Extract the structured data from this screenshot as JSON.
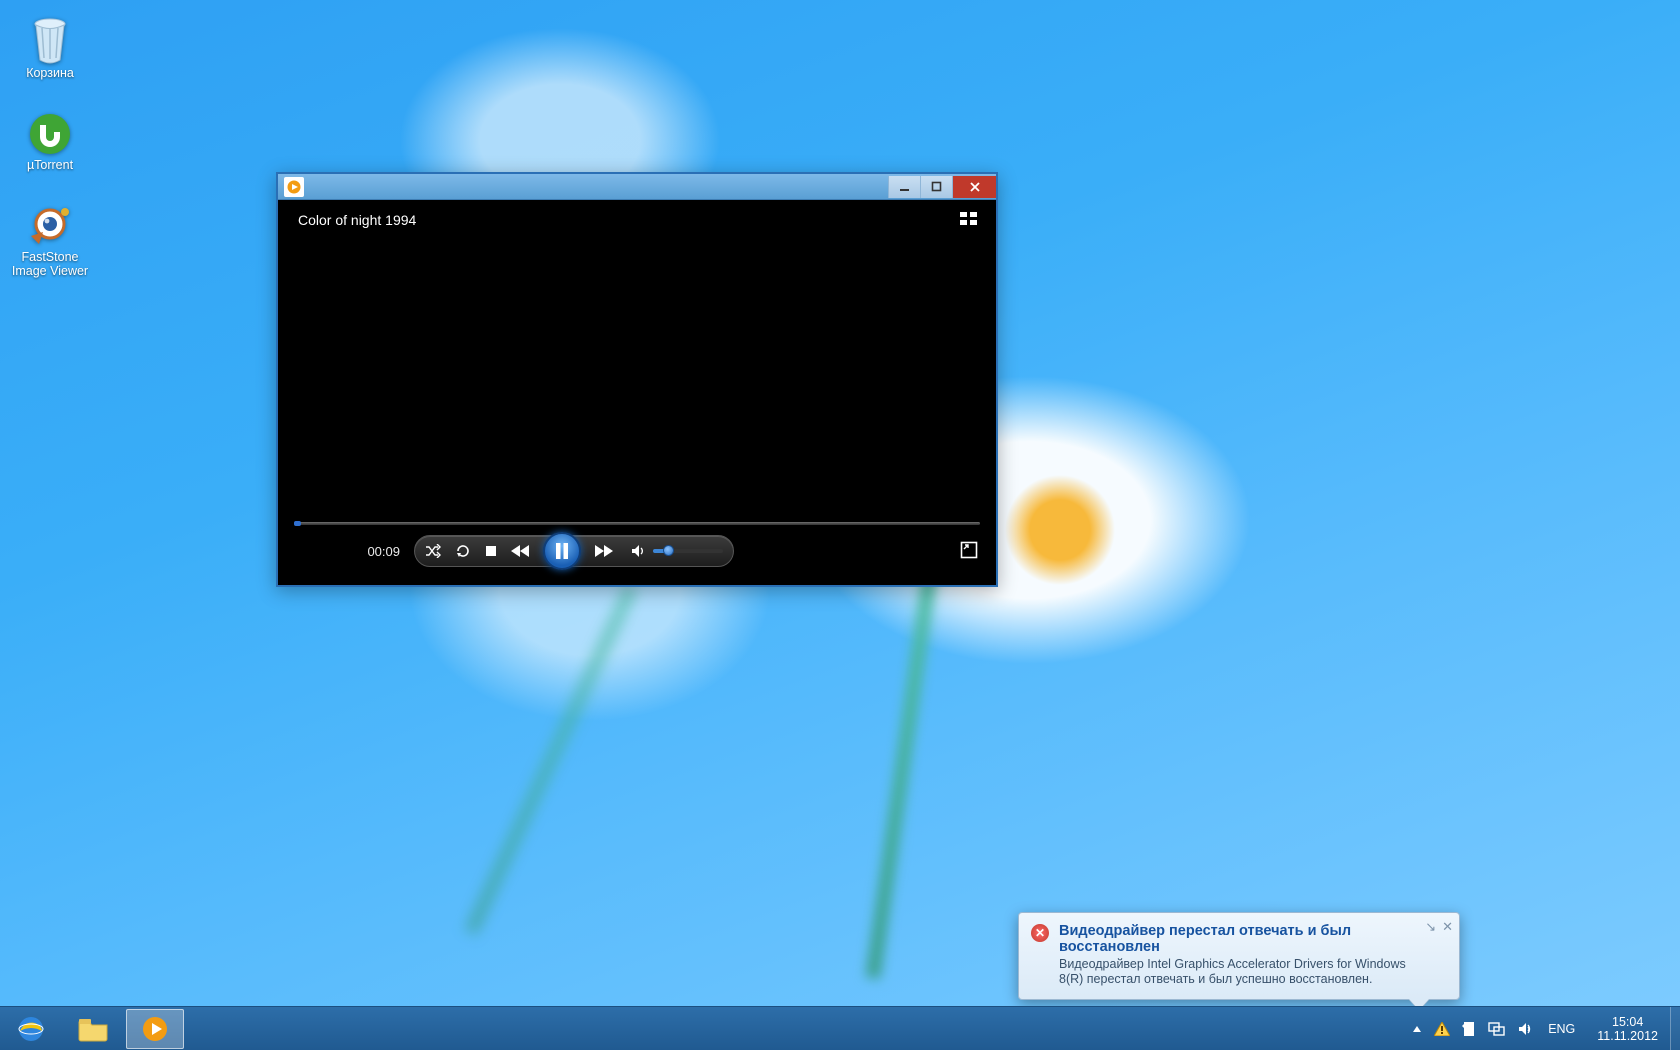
{
  "desktop": {
    "icons": [
      {
        "id": "recycle-bin",
        "label": "Корзина"
      },
      {
        "id": "utorrent",
        "label": "µTorrent"
      },
      {
        "id": "faststone",
        "label": "FastStone\nImage Viewer"
      }
    ]
  },
  "player_window": {
    "app": "Windows Media Player",
    "video_title": "Color of night 1994",
    "elapsed": "00:09",
    "seek_progress_pct": 1,
    "volume_pct": 22,
    "state": "playing"
  },
  "notification": {
    "title": "Видеодрайвер перестал отвечать и был восстановлен",
    "body": "Видеодрайвер Intel Graphics Accelerator Drivers for Windows 8(R) перестал отвечать и был успешно восстановлен.",
    "severity": "error"
  },
  "taskbar": {
    "pinned": [
      {
        "id": "ie",
        "name": "Internet Explorer",
        "active": false
      },
      {
        "id": "explorer",
        "name": "File Explorer",
        "active": false
      },
      {
        "id": "wmp",
        "name": "Windows Media Player",
        "active": true
      }
    ],
    "tray": {
      "language": "ENG",
      "time": "15:04",
      "date": "11.11.2012",
      "icons": [
        "hidden-tray",
        "warning",
        "action-center",
        "network",
        "volume"
      ]
    }
  },
  "colors": {
    "accent": "#2a6fb5",
    "close": "#c0392b",
    "taskbar": "#205a91"
  }
}
